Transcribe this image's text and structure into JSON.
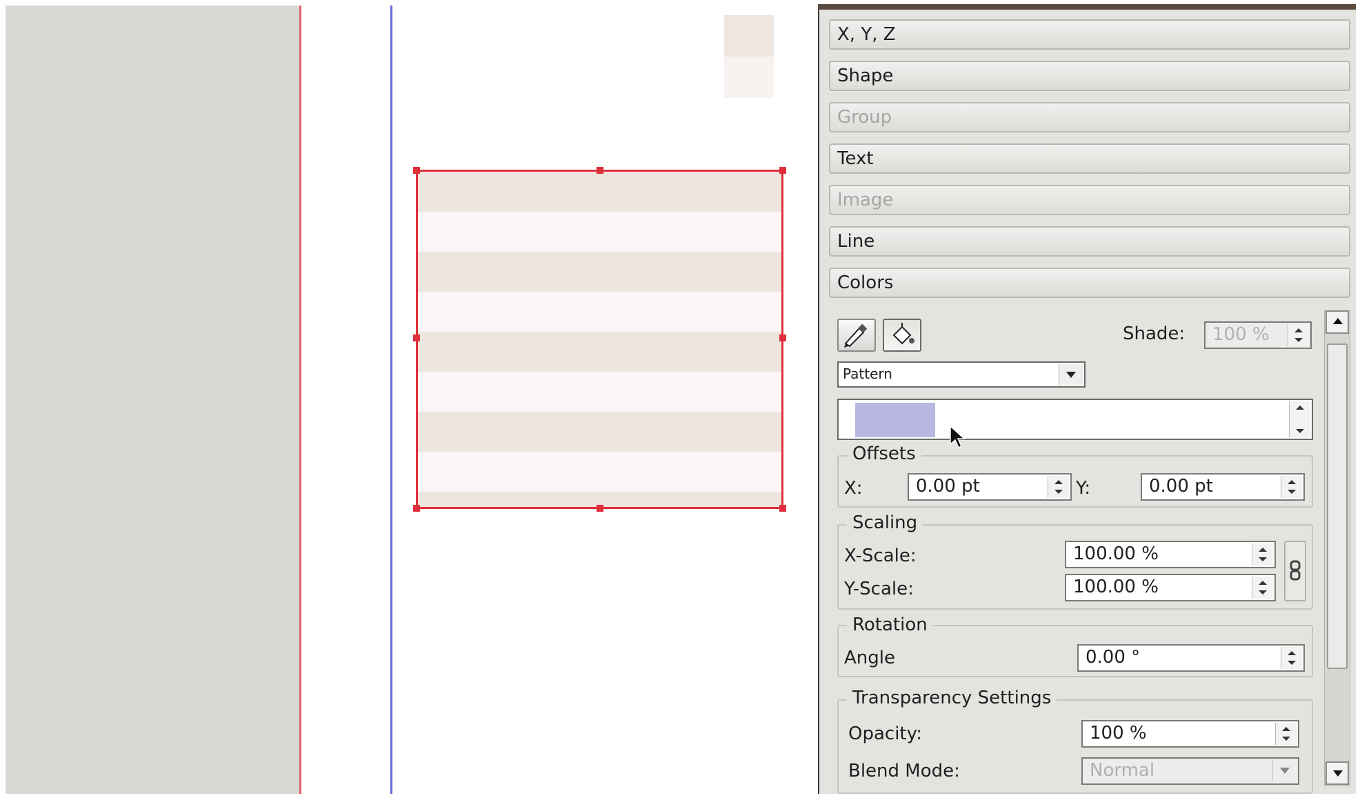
{
  "panel": {
    "tabs": [
      {
        "label": "X, Y, Z",
        "enabled": true
      },
      {
        "label": "Shape",
        "enabled": true
      },
      {
        "label": "Group",
        "enabled": false
      },
      {
        "label": "Text",
        "enabled": true
      },
      {
        "label": "Image",
        "enabled": false
      },
      {
        "label": "Line",
        "enabled": true
      },
      {
        "label": "Colors",
        "enabled": true
      }
    ],
    "colors": {
      "edit_line_icon": "pen-icon",
      "edit_fill_icon": "fill-bucket-icon",
      "shade_label": "Shade:",
      "shade_value": "100 %",
      "fill_type": "Pattern",
      "pattern_swatch_color": "#b7b7e0",
      "offsets": {
        "legend": "Offsets",
        "x_label": "X:",
        "x_value": "0.00 pt",
        "y_label": "Y:",
        "y_value": "0.00 pt"
      },
      "scaling": {
        "legend": "Scaling",
        "x_label": "X-Scale:",
        "x_value": "100.00 %",
        "y_label": "Y-Scale:",
        "y_value": "100.00 %",
        "link_icon": "chain-link-icon"
      },
      "rotation": {
        "legend": "Rotation",
        "angle_label": "Angle",
        "angle_value": "0.00 °"
      },
      "transparency": {
        "legend": "Transparency Settings",
        "opacity_label": "Opacity:",
        "opacity_value": "100 %",
        "blend_label": "Blend Mode:",
        "blend_value": "Normal"
      }
    }
  },
  "canvas": {
    "shape_colors": {
      "border": "#e0303c",
      "stripe_a": "#efe5df",
      "stripe_b": "#faf7f6"
    },
    "page_edge_color": "#e0606a",
    "margin_guide_color": "#6a6ad8"
  }
}
